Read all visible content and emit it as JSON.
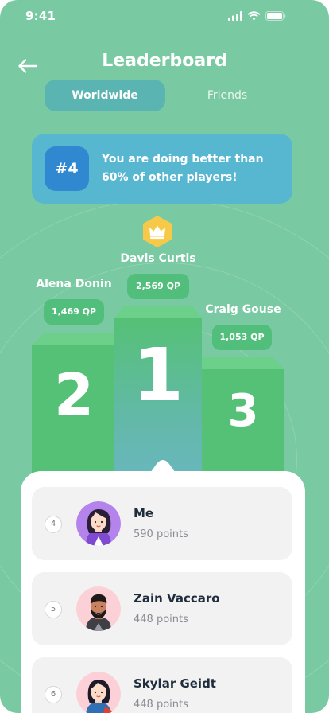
{
  "status_bar": {
    "time": "9:41"
  },
  "header": {
    "title": "Leaderboard"
  },
  "tabs": [
    {
      "label": "Worldwide",
      "active": true
    },
    {
      "label": "Friends",
      "active": false
    }
  ],
  "rank_banner": {
    "rank": "#4",
    "message": "You are doing better than 60% of other players!"
  },
  "podium": {
    "first": {
      "place": "1",
      "name": "Davis Curtis",
      "points": "2,569 QP"
    },
    "second": {
      "place": "2",
      "name": "Alena Donin",
      "points": "1,469 QP"
    },
    "third": {
      "place": "3",
      "name": "Craig Gouse",
      "points": "1,053 QP"
    }
  },
  "list": [
    {
      "rank": "4",
      "name": "Me",
      "points": "590 points",
      "avatar": "avatar-woman-purple"
    },
    {
      "rank": "5",
      "name": "Zain Vaccaro",
      "points": "448 points",
      "avatar": "avatar-man-beard"
    },
    {
      "rank": "6",
      "name": "Skylar Geidt",
      "points": "448 points",
      "avatar": "avatar-woman-pink"
    }
  ],
  "colors": {
    "background": "#79c9a2",
    "tab_active": "#5ab5b2",
    "banner": "#57b7d1",
    "rank_badge": "#2f88d0",
    "podium": "#55c176",
    "crown_badge": "#f7c948"
  },
  "icons": {
    "back": "arrow-left-icon",
    "crown": "crown-icon",
    "signal": "signal-icon",
    "wifi": "wifi-icon",
    "battery": "battery-icon"
  }
}
